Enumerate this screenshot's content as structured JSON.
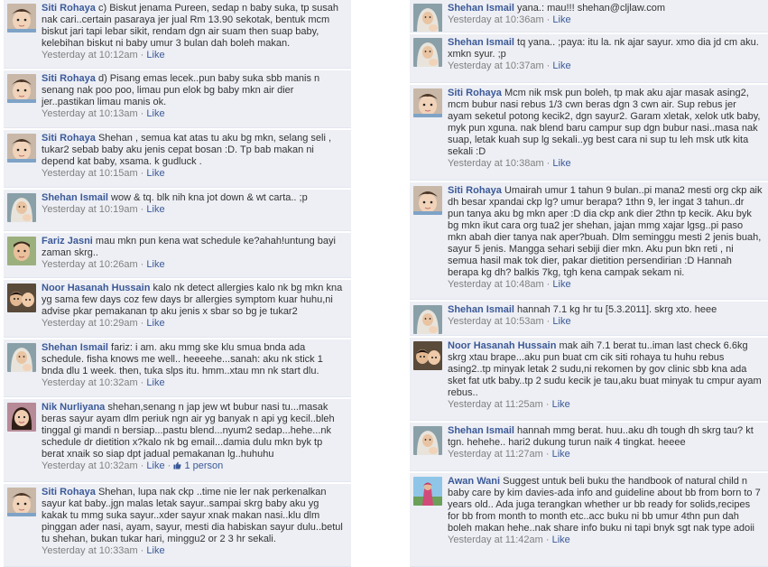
{
  "colors": {
    "link": "#3b5998",
    "bg": "#edeff4",
    "meta": "#808080"
  },
  "left_comments": [
    {
      "author": "Siti Rohaya",
      "avatar": "baby-avatar",
      "text": "c) Biskut jenama Pureen, sedap n baby suka, tp susah nak cari..certain pasaraya jer jual Rm 13.90 sekotak, bentuk mcm biskut jari tapi lebar sikit, rendam dgn air suam then suap baby, kelebihan biskut ni baby umur 3 bulan dah boleh makan.",
      "time": "Yesterday at 10:12am",
      "like": "Like"
    },
    {
      "author": "Siti Rohaya",
      "avatar": "baby-avatar",
      "text": "d) Pisang emas lecek..pun baby suka sbb manis n senang nak poo poo, limau pun elok bg baby mkn air dier jer..pastikan limau manis ok.",
      "time": "Yesterday at 10:13am",
      "like": "Like"
    },
    {
      "author": "Siti Rohaya",
      "avatar": "baby-avatar",
      "text": "Shehan , semua kat atas tu aku bg mkn, selang seli , tukar2 sebab baby aku jenis cepat bosan :D. Tp bab makan ni depend kat baby, xsama. k gudluck .",
      "time": "Yesterday at 10:15am",
      "like": "Like"
    },
    {
      "author": "Shehan Ismail",
      "avatar": "hijab-avatar",
      "text": "wow & tq. blk nih kna jot down & wt carta.. ;p",
      "time": "Yesterday at 10:19am",
      "like": "Like"
    },
    {
      "author": "Fariz Jasni",
      "avatar": "child-avatar",
      "text": "mau mkn pun kena wat schedule ke?ahah!untung bayi zaman skrg..",
      "time": "Yesterday at 10:26am",
      "like": "Like"
    },
    {
      "author": "Noor Hasanah Hussain",
      "avatar": "kids-avatar",
      "text": "kalo nk detect allergies kalo nk bg mkn kna yg sama few days coz few days br allergies symptom kuar huhu,ni advise pkar pemakanan tp aku jenis x sbar so bg je tukar2",
      "time": "Yesterday at 10:29am",
      "like": "Like"
    },
    {
      "author": "Shehan Ismail",
      "avatar": "hijab-avatar",
      "text": "fariz: i am. aku mmg ske klu smua bnda ada schedule. fisha knows me well.. heeeehe...sanah: aku nk stick 1 bnda dlu 1 week. then, tuka slps itu. hmm..xtau mn nk start dlu.",
      "time": "Yesterday at 10:32am",
      "like": "Like"
    },
    {
      "author": "Nik Nurliyana",
      "avatar": "girl-avatar",
      "text": "shehan,senang n jap jew wt bubur nasi tu...masak beras sayur ayam dlm periuk ngn air yg banyak n api yg kecil..bleh tinggal gi mandi n bersiap...pastu blend...nyum2 sedap...hehe...nk schedule dr dietition x?kalo nk bg email...damia dulu mkn byk tp berat xnaik so siap dpt jadual pemakanan lg..huhuhu",
      "time": "Yesterday at 10:32am",
      "like": "Like",
      "like_count": "1 person"
    },
    {
      "author": "Siti Rohaya",
      "avatar": "baby-avatar",
      "text": "Shehan, lupa nak ckp ..time nie ler nak perkenalkan sayur kat baby..jgn malas letak sayur..sampai skrg baby aku yg kakak tu mmg suka sayur..xder sayur xnak makan nasi..klu dlm pinggan ader nasi, ayam, sayur, mesti dia habiskan sayur dulu..betul tu shehan, bukan tukar hari, minggu2 or 2 3 hr sekali.",
      "time": "Yesterday at 10:33am",
      "like": "Like"
    }
  ],
  "right_comments": [
    {
      "author": "Shehan Ismail",
      "avatar": "hijab-avatar",
      "text": "yana.: mau!!! shehan@cljlaw.com",
      "time": "Yesterday at 10:36am",
      "like": "Like"
    },
    {
      "author": "Shehan Ismail",
      "avatar": "hijab-avatar",
      "text": "tq yana.. ;paya: itu la. nk ajar sayur. xmo dia jd cm aku. xmkn syur. ;p",
      "time": "Yesterday at 10:37am",
      "like": "Like"
    },
    {
      "author": "Siti Rohaya",
      "avatar": "baby-avatar",
      "text": "Mcm nik msk pun boleh, tp mak aku ajar masak asing2, mcm bubur nasi rebus 1/3 cwn beras dgn 3 cwn air. Sup rebus jer ayam seketul potong kecik2, dgn sayur2. Garam xletak, xelok utk baby, myk pun xguna. nak blend baru campur sup dgn bubur nasi..masa nak suap, letak kuah sup lg sekali..yg best cara ni sup tu leh msk utk kita sekali :D",
      "time": "Yesterday at 10:38am",
      "like": "Like"
    },
    {
      "author": "Siti Rohaya",
      "avatar": "baby-avatar",
      "text": "Umairah umur 1 tahun 9 bulan..pi mana2 mesti org ckp aik dh besar xpandai ckp lg? umur berapa? 1thn 9, ler ingat 3 tahun..dr pun tanya aku bg mkn aper :D dia ckp ank dier 2thn tp kecik. Aku byk bg mkn ikut cara org tua2 jer shehan, jajan mmg xajar lgsg..pi paso mkn abah dier tanya nak aper?buah. Dlm seminggu mesti 2 jenis buah, sayur 5 jenis. Mangga sehari sebiji dier mkn. Aku pun bkn reti , ni semua hasil mak tok dier, pakar dietition persendirian :D Hannah berapa kg dh? balkis 7kg, tgh kena campak sekam ni.",
      "time": "Yesterday at 10:48am",
      "like": "Like"
    },
    {
      "author": "Shehan Ismail",
      "avatar": "hijab-avatar",
      "text": "hannah 7.1 kg hr tu [5.3.2011]. skrg xto. heee",
      "time": "Yesterday at 10:53am",
      "like": "Like"
    },
    {
      "author": "Noor Hasanah Hussain",
      "avatar": "kids-avatar",
      "text": "mak aih 7.1 berat tu..iman last check 6.6kg skrg xtau brape...aku pun buat cm cik siti rohaya tu huhu rebus asing2..tp minyak letak 2 sudu,ni rekomen by gov clinic sbb kna ada sket fat utk baby..tp 2 sudu kecik je tau,aku buat minyak tu cmpur ayam rebus..",
      "time": "Yesterday at 11:25am",
      "like": "Like"
    },
    {
      "author": "Shehan Ismail",
      "avatar": "hijab-avatar",
      "text": "hannah mmg berat. huu..aku dh tough dh skrg tau? kt tgn. hehehe.. hari2 dukung turun naik 4 tingkat. heeee",
      "time": "Yesterday at 11:27am",
      "like": "Like"
    },
    {
      "author": "Awan Wani",
      "avatar": "woman-avatar",
      "text": "Suggest untuk beli buku the handbook of natural child n baby care by kim davies-ada info and guideline about bb from born to 7 years old.. Ada juga terangkan whether ur bb ready for solids,recipes for bb from month to month etc..acc buku ni bb umur 4thn pun dah boleh makan hehe..nak share info buku ni tapi bnyk sgt nak type adoii",
      "time": "Yesterday at 11:42am",
      "like": "Like"
    }
  ]
}
